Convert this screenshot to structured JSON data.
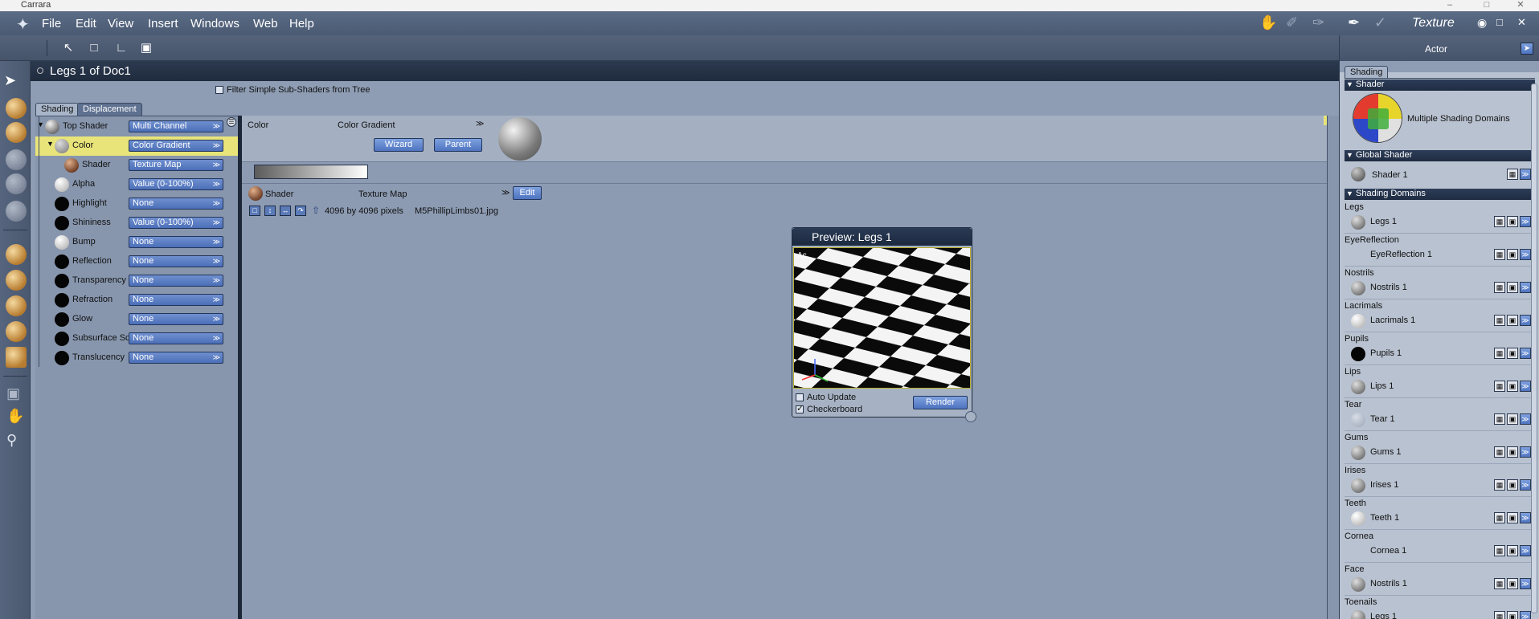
{
  "window": {
    "title": "Carrara"
  },
  "menu": {
    "items": [
      "File",
      "Edit",
      "View",
      "Insert",
      "Windows",
      "Web",
      "Help"
    ],
    "room": "Texture"
  },
  "document": {
    "title": "Legs 1 of Doc1",
    "filter_label": "Filter Simple Sub-Shaders from Tree"
  },
  "tabs": [
    "Shading",
    "Displacement"
  ],
  "tree": [
    {
      "label": "Top Shader",
      "value": "Multi Channel",
      "ball": "grey"
    },
    {
      "label": "Color",
      "value": "Color Gradient",
      "ball": "mid"
    },
    {
      "label": "Shader",
      "value": "Texture Map",
      "ball": "brown"
    },
    {
      "label": "Alpha",
      "value": "Value (0-100%)",
      "ball": "white"
    },
    {
      "label": "Highlight",
      "value": "None",
      "ball": "black"
    },
    {
      "label": "Shininess",
      "value": "Value (0-100%)",
      "ball": "black"
    },
    {
      "label": "Bump",
      "value": "None",
      "ball": "white"
    },
    {
      "label": "Reflection",
      "value": "None",
      "ball": "black"
    },
    {
      "label": "Transparency",
      "value": "None",
      "ball": "black"
    },
    {
      "label": "Refraction",
      "value": "None",
      "ball": "black"
    },
    {
      "label": "Glow",
      "value": "None",
      "ball": "black"
    },
    {
      "label": "Subsurface Scattering",
      "value": "None",
      "ball": "black"
    },
    {
      "label": "Translucency",
      "value": "None",
      "ball": "black"
    }
  ],
  "editor": {
    "channel_label": "Color",
    "channel_value": "Color Gradient",
    "wizard": "Wizard",
    "parent": "Parent",
    "shader_label": "Shader",
    "shader_value": "Texture Map",
    "edit": "Edit",
    "image_size": "4096 by 4096 pixels",
    "image_file": "M5PhillipLimbs01.jpg"
  },
  "preview": {
    "title": "Preview: Legs 1",
    "overlay": "Ac",
    "auto_update": "Auto Update",
    "checkerboard": "Checkerboard",
    "render": "Render"
  },
  "right_panel": {
    "header": "Actor",
    "tab": "Shading",
    "shader_section": "Shader",
    "shader_name": "Multiple Shading Domains",
    "global_section": "Global Shader",
    "global_shader": "Shader 1",
    "domains_section": "Shading Domains",
    "domains": [
      {
        "name": "Legs",
        "shader": "Legs 1",
        "ball": "mid"
      },
      {
        "name": "EyeReflection",
        "shader": "EyeReflection 1",
        "ball": "none"
      },
      {
        "name": "Nostrils",
        "shader": "Nostrils 1",
        "ball": "mid"
      },
      {
        "name": "Lacrimals",
        "shader": "Lacrimals 1",
        "ball": "white"
      },
      {
        "name": "Pupils",
        "shader": "Pupils 1",
        "ball": "black"
      },
      {
        "name": "Lips",
        "shader": "Lips 1",
        "ball": "mid"
      },
      {
        "name": "Tear",
        "shader": "Tear 1",
        "ball": "pale"
      },
      {
        "name": "Gums",
        "shader": "Gums 1",
        "ball": "mid"
      },
      {
        "name": "Irises",
        "shader": "Irises 1",
        "ball": "mid"
      },
      {
        "name": "Teeth",
        "shader": "Teeth 1",
        "ball": "white"
      },
      {
        "name": "Cornea",
        "shader": "Cornea 1",
        "ball": "none"
      },
      {
        "name": "Face",
        "shader": "Nostrils 1",
        "ball": "mid"
      },
      {
        "name": "Toenails",
        "shader": "Legs 1",
        "ball": "mid"
      }
    ]
  },
  "colors": {
    "selection": "#e8e47a",
    "button_blue": "#4e74c0",
    "header_dark": "#1f2b3d"
  }
}
